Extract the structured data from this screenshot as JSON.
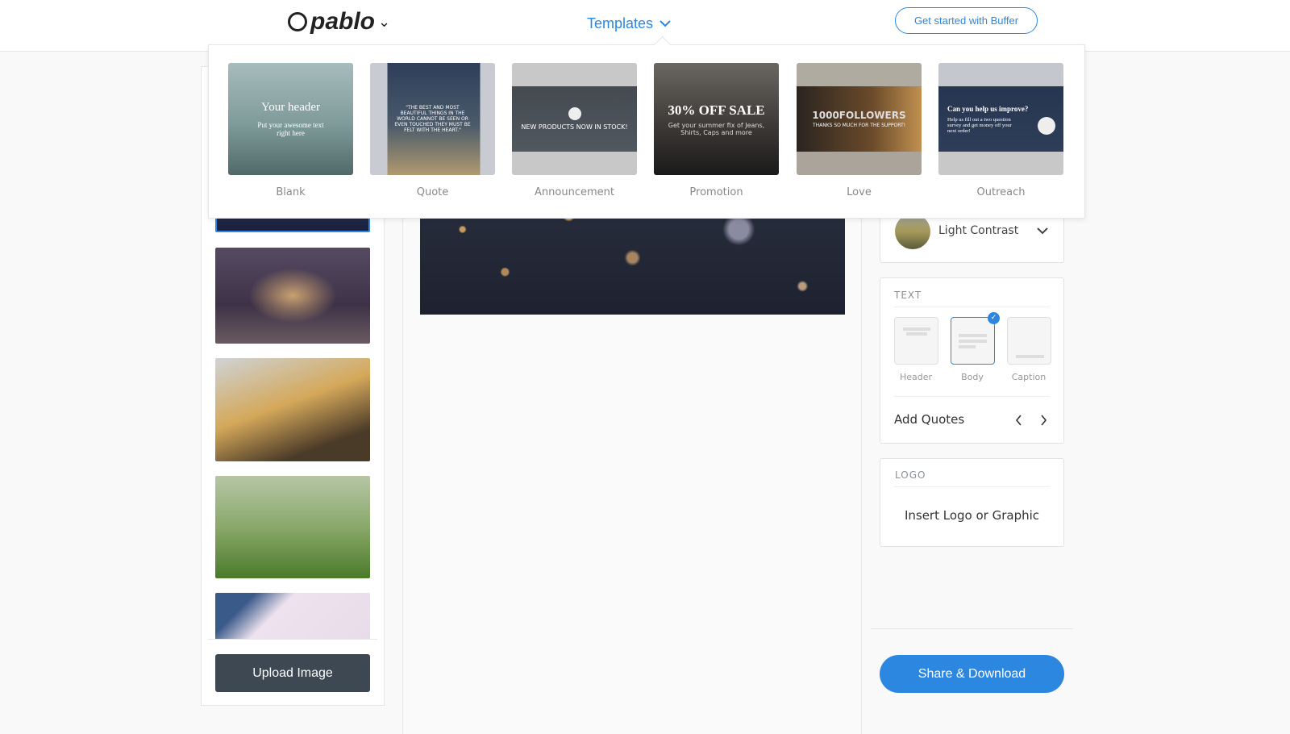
{
  "header": {
    "logo": "pablo",
    "templates_label": "Templates",
    "cta": "Get started with Buffer"
  },
  "templates": [
    {
      "label": "Blank",
      "title": "Your header",
      "text": "Put your awesome text right here"
    },
    {
      "label": "Quote",
      "text": "\"The best and most beautiful things in the world cannot be seen or even touched they must be felt with the heart.\""
    },
    {
      "label": "Announcement",
      "title": "NEW PRODUCTS NOW IN STOCK!"
    },
    {
      "label": "Promotion",
      "title": "30% OFF SALE",
      "text": "Get your summer fix of Jeans, Shirts, Caps and more"
    },
    {
      "label": "Love",
      "title": "1000FOLLOWERS",
      "text": "Thanks so much for the support!"
    },
    {
      "label": "Outreach",
      "title": "Can you help us improve?",
      "text": "Help us fill out a two question survey and get money off your next order!"
    }
  ],
  "left": {
    "upload": "Upload Image"
  },
  "filter": {
    "label": "Light Contrast"
  },
  "text_panel": {
    "title": "TEXT",
    "options": [
      "Header",
      "Body",
      "Caption"
    ],
    "selected": "Body",
    "add_quotes": "Add Quotes"
  },
  "logo_panel": {
    "title": "LOGO",
    "insert": "Insert Logo or Graphic"
  },
  "share": "Share & Download",
  "colors": {
    "accent": "#2c87e0",
    "upload_bg": "#3d4852"
  }
}
